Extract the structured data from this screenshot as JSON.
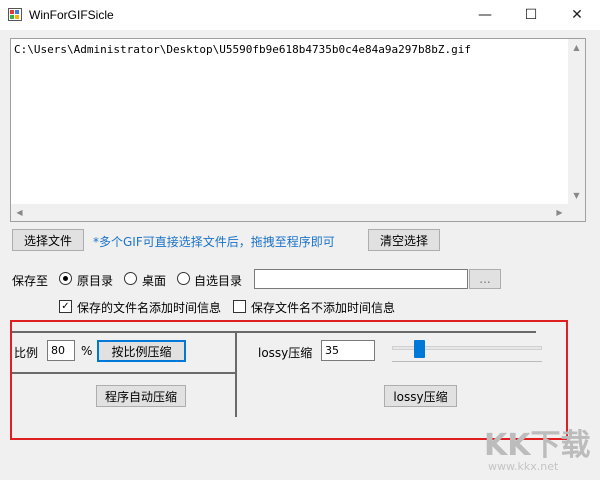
{
  "window": {
    "title": "WinForGIFSicle",
    "minimize": "—",
    "maximize": "☐",
    "close": "✕"
  },
  "file_list": {
    "items": [
      "C:\\Users\\Administrator\\Desktop\\U5590fb9e618b4735b0c4e84a9a297b8bZ.gif"
    ]
  },
  "actions": {
    "select_files": "选择文件",
    "hint": "*多个GIF可直接选择文件后，拖拽至程序即可",
    "clear_selection": "清空选择"
  },
  "save": {
    "label": "保存至",
    "options": [
      "原目录",
      "桌面",
      "自选目录"
    ],
    "selected": "原目录",
    "custom_path": "",
    "browse": "..."
  },
  "filename_options": {
    "add_time": "保存的文件名添加时间信息",
    "add_time_checked": true,
    "no_time": "保存文件名不添加时间信息",
    "no_time_checked": false
  },
  "ratio": {
    "label": "比例",
    "value": "80",
    "unit": "%",
    "compress_button": "按比例压缩",
    "auto_button": "程序自动压缩"
  },
  "lossy": {
    "label": "lossy压缩",
    "value": "35",
    "slider_fraction": 0.17,
    "button": "lossy压缩"
  },
  "watermark": {
    "brand": "KK下载",
    "url": "www.kkx.net"
  },
  "colors": {
    "accent": "#0078d7",
    "hint": "#1a73c8",
    "highlight_frame": "#e02020"
  }
}
